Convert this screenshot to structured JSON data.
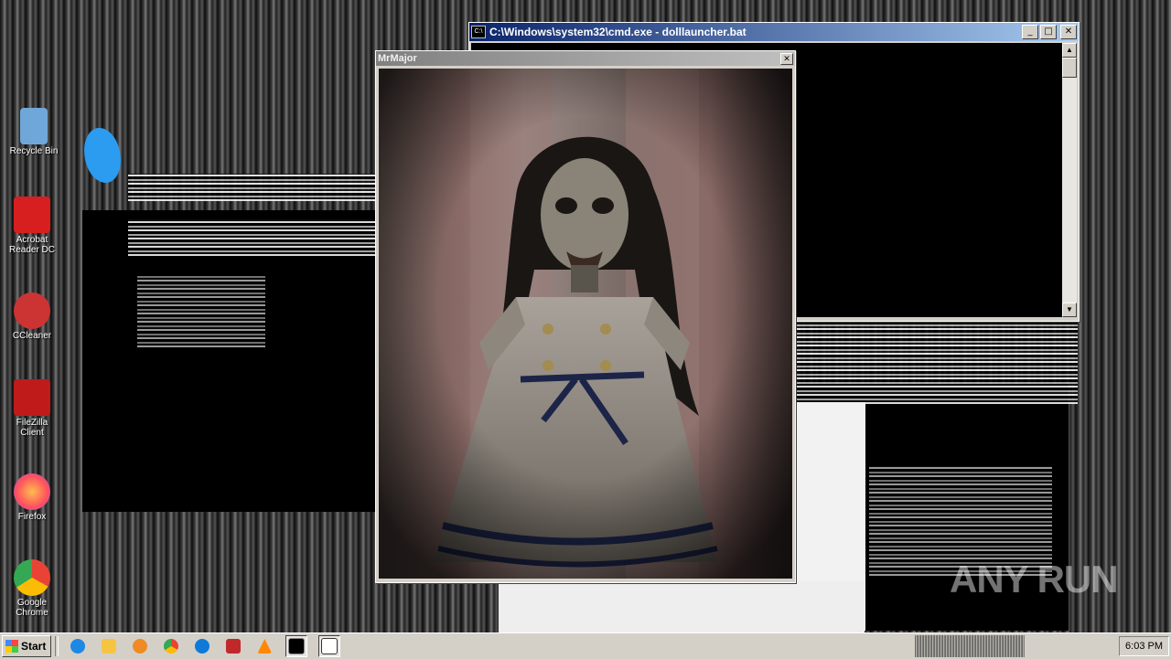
{
  "cmd_window": {
    "title": "C:\\Windows\\system32\\cmd.exe - dolllauncher.bat",
    "minimize_glyph": "_",
    "maximize_glyph": "□",
    "close_glyph": "✕"
  },
  "image_window": {
    "title": "MrMajor",
    "close_glyph": "✕"
  },
  "desktop_icons": [
    {
      "label": "Recycle Bin",
      "icon": "recycle-bin-icon",
      "color": "#6fa7d8"
    },
    {
      "label": "Acrobat Reader DC",
      "icon": "acrobat-reader-icon",
      "color": "#d71f1f"
    },
    {
      "label": "CCleaner",
      "icon": "ccleaner-icon",
      "color": "#cc3333"
    },
    {
      "label": "FileZilla Client",
      "icon": "filezilla-icon",
      "color": "#bf1b1b"
    },
    {
      "label": "Firefox",
      "icon": "firefox-icon",
      "color": "#ff7b2a"
    },
    {
      "label": "Google Chrome",
      "icon": "chrome-icon",
      "color": "#34a853"
    }
  ],
  "taskbar": {
    "start_label": "Start",
    "clock": "6:03 PM",
    "icons": [
      "ie-icon",
      "explorer-icon",
      "media-player-icon",
      "chrome-icon",
      "edge-icon",
      "app-icon",
      "vlc-icon",
      "cmd-icon",
      "window-icon"
    ]
  },
  "watermark": "ANY RUN"
}
